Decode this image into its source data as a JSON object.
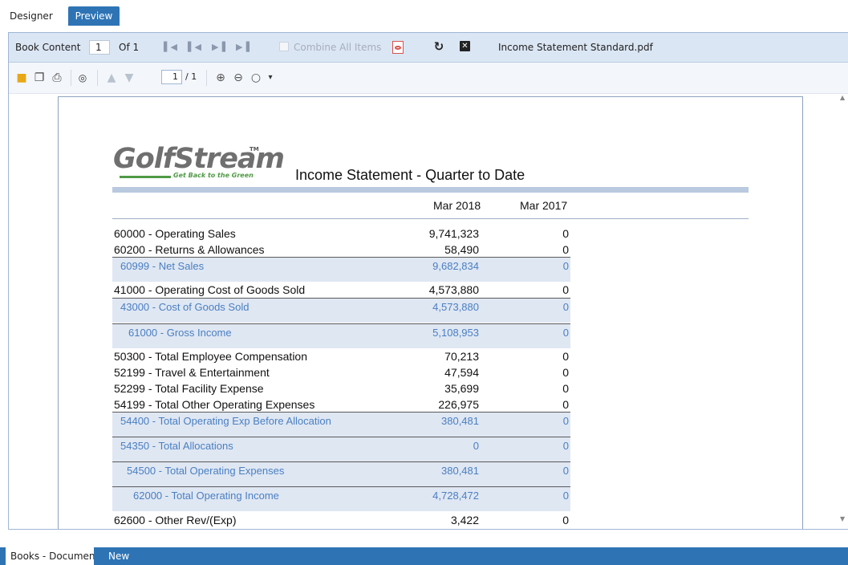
{
  "mode_tabs": {
    "designer": "Designer",
    "preview": "Preview"
  },
  "book_toolbar": {
    "book_content_label": "Book Content",
    "book_index": "1",
    "of_label": "Of 1",
    "combine_label": "Combine All Items",
    "file_name": "Income Statement Standard.pdf"
  },
  "viewer_toolbar": {
    "page_value": "1",
    "page_total": "/ 1"
  },
  "report": {
    "logo_text": "GolfStream",
    "logo_tm": "TM",
    "logo_tagline": "Get Back to the Green",
    "title": "Income Statement - Quarter to Date",
    "columns": [
      "Mar 2018",
      "Mar 2017"
    ],
    "rows": [
      {
        "label": "60000 - Operating Sales",
        "v1": "9,741,323",
        "v2": "0",
        "type": "normal"
      },
      {
        "label": "60200 - Returns & Allowances",
        "v1": "58,490",
        "v2": "0",
        "type": "normal"
      },
      {
        "label": "60999 - Net Sales",
        "v1": "9,682,834",
        "v2": "0",
        "type": "sub"
      },
      {
        "label": "41000 - Operating Cost of Goods Sold",
        "v1": "4,573,880",
        "v2": "0",
        "type": "normal"
      },
      {
        "label": "43000 - Cost of Goods Sold",
        "v1": "4,573,880",
        "v2": "0",
        "type": "sub"
      },
      {
        "label": "61000 - Gross Income",
        "v1": "5,108,953",
        "v2": "0",
        "type": "sub"
      },
      {
        "label": "50300 - Total Employee Compensation",
        "v1": "70,213",
        "v2": "0",
        "type": "normal"
      },
      {
        "label": "52199 - Travel & Entertainment",
        "v1": "47,594",
        "v2": "0",
        "type": "normal"
      },
      {
        "label": "52299 - Total Facility Expense",
        "v1": "35,699",
        "v2": "0",
        "type": "normal"
      },
      {
        "label": "54199 - Total Other Operating Expenses",
        "v1": "226,975",
        "v2": "0",
        "type": "normal"
      },
      {
        "label": "54400 - Total Operating Exp Before Allocation",
        "v1": "380,481",
        "v2": "0",
        "type": "sub"
      },
      {
        "label": "54350 - Total Allocations",
        "v1": "0",
        "v2": "0",
        "type": "sub"
      },
      {
        "label": "54500 - Total Operating Expenses",
        "v1": "380,481",
        "v2": "0",
        "type": "sub"
      },
      {
        "label": "62000 - Total Operating Income",
        "v1": "4,728,472",
        "v2": "0",
        "type": "sub"
      },
      {
        "label": "62600 - Other Rev/(Exp)",
        "v1": "3,422",
        "v2": "0",
        "type": "normal"
      }
    ]
  },
  "bottom_tabs": {
    "active": "Books - Documen",
    "new": "New"
  }
}
